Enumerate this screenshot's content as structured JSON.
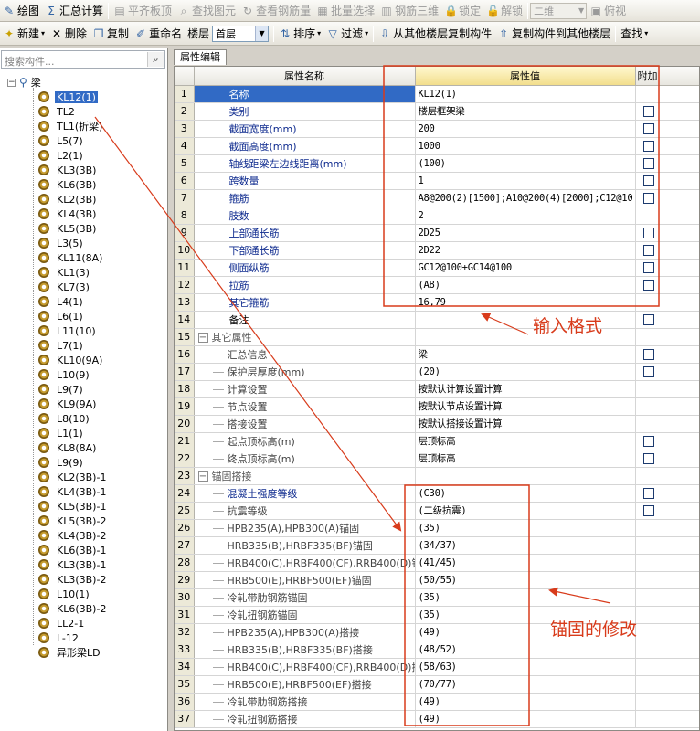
{
  "toolbar1": {
    "items": [
      {
        "label": "绘图",
        "icon": "✎",
        "name": "draw-button",
        "disabled": false
      },
      {
        "label": "汇总计算",
        "icon": "Σ",
        "name": "summary-calc-button",
        "disabled": false
      },
      {
        "label": "平齐板顶",
        "icon": "▤",
        "name": "align-slab-top-button",
        "disabled": true
      },
      {
        "label": "查找图元",
        "icon": "⌕",
        "name": "find-element-button",
        "disabled": true
      },
      {
        "label": "查看钢筋量",
        "icon": "↻",
        "name": "view-rebar-button",
        "disabled": true
      },
      {
        "label": "批量选择",
        "icon": "▦",
        "name": "batch-select-button",
        "disabled": true
      },
      {
        "label": "钢筋三维",
        "icon": "▥",
        "name": "rebar-3d-button",
        "disabled": true
      },
      {
        "label": "锁定",
        "icon": "🔒",
        "name": "lock-button",
        "disabled": true
      },
      {
        "label": "解锁",
        "icon": "🔓",
        "name": "unlock-button",
        "disabled": true
      }
    ],
    "view_mode": "二维",
    "view_label": "俯视"
  },
  "toolbar2": {
    "new_label": "新建",
    "delete_label": "删除",
    "copy_label": "复制",
    "rename_label": "重命名",
    "floor_label": "楼层",
    "floor_value": "首层",
    "sort_label": "排序",
    "filter_label": "过滤",
    "copy_from_label": "从其他楼层复制构件",
    "copy_to_label": "复制构件到其他楼层",
    "find_label": "查找"
  },
  "search": {
    "placeholder": "搜索构件..."
  },
  "tree": {
    "root": "梁",
    "items": [
      "KL12(1)",
      "TL2",
      "TL1(折梁)",
      "L5(7)",
      "L2(1)",
      "KL3(3B)",
      "KL6(3B)",
      "KL2(3B)",
      "KL4(3B)",
      "KL5(3B)",
      "L3(5)",
      "KL11(8A)",
      "KL1(3)",
      "KL7(3)",
      "L4(1)",
      "L6(1)",
      "L11(10)",
      "L7(1)",
      "KL10(9A)",
      "L10(9)",
      "L9(7)",
      "KL9(9A)",
      "L8(10)",
      "L1(1)",
      "KL8(8A)",
      "L9(9)",
      "KL2(3B)-1",
      "KL4(3B)-1",
      "KL5(3B)-1",
      "KL5(3B)-2",
      "KL4(3B)-2",
      "KL6(3B)-1",
      "KL3(3B)-1",
      "KL3(3B)-2",
      "L10(1)",
      "KL6(3B)-2",
      "LL2-1",
      "L-12",
      "异形梁LD"
    ],
    "selected_index": 0
  },
  "tab": {
    "label": "属性编辑"
  },
  "grid": {
    "headers": {
      "name": "属性名称",
      "value": "属性值",
      "add": "附加"
    },
    "rows": [
      {
        "n": "1",
        "name": "名称",
        "value": "KL12(1)",
        "style": "hl",
        "cb": false
      },
      {
        "n": "2",
        "name": "类别",
        "value": "楼层框架梁",
        "style": "blue",
        "cb": true
      },
      {
        "n": "3",
        "name": "截面宽度(mm)",
        "value": "200",
        "style": "blue",
        "cb": true
      },
      {
        "n": "4",
        "name": "截面高度(mm)",
        "value": "1000",
        "style": "blue",
        "cb": true
      },
      {
        "n": "5",
        "name": "轴线距梁左边线距离(mm)",
        "value": "(100)",
        "style": "blue",
        "cb": true
      },
      {
        "n": "6",
        "name": "跨数量",
        "value": "1",
        "style": "blue",
        "cb": true
      },
      {
        "n": "7",
        "name": "箍筋",
        "value": "A8@200(2)[1500];A10@200(4)[2000];C12@10",
        "style": "blue",
        "cb": true
      },
      {
        "n": "8",
        "name": "肢数",
        "value": "2",
        "style": "blue",
        "cb": false
      },
      {
        "n": "9",
        "name": "上部通长筋",
        "value": "2D25",
        "style": "blue",
        "cb": true
      },
      {
        "n": "10",
        "name": "下部通长筋",
        "value": "2D22",
        "style": "blue",
        "cb": true
      },
      {
        "n": "11",
        "name": "侧面纵筋",
        "value": "GC12@100+GC14@100",
        "style": "blue",
        "cb": true
      },
      {
        "n": "12",
        "name": "拉筋",
        "value": "(A8)",
        "style": "blue",
        "cb": true
      },
      {
        "n": "13",
        "name": "其它箍筋",
        "value": "16,79",
        "style": "blue",
        "cb": false
      },
      {
        "n": "14",
        "name": "备注",
        "value": "",
        "style": "plain",
        "cb": true
      },
      {
        "n": "15",
        "name": "其它属性",
        "value": "",
        "style": "group",
        "cb": false
      },
      {
        "n": "16",
        "name": "汇总信息",
        "value": "梁",
        "style": "sub",
        "cb": true
      },
      {
        "n": "17",
        "name": "保护层厚度(mm)",
        "value": "(20)",
        "style": "sub",
        "cb": true
      },
      {
        "n": "18",
        "name": "计算设置",
        "value": "按默认计算设置计算",
        "style": "sub",
        "cb": false
      },
      {
        "n": "19",
        "name": "节点设置",
        "value": "按默认节点设置计算",
        "style": "sub",
        "cb": false
      },
      {
        "n": "20",
        "name": "搭接设置",
        "value": "按默认搭接设置计算",
        "style": "sub",
        "cb": false
      },
      {
        "n": "21",
        "name": "起点顶标高(m)",
        "value": "层顶标高",
        "style": "sub",
        "cb": true
      },
      {
        "n": "22",
        "name": "终点顶标高(m)",
        "value": "层顶标高",
        "style": "sub",
        "cb": true
      },
      {
        "n": "23",
        "name": "锚固搭接",
        "value": "",
        "style": "group",
        "cb": false
      },
      {
        "n": "24",
        "name": "混凝土强度等级",
        "value": "(C30)",
        "style": "subblue",
        "cb": true
      },
      {
        "n": "25",
        "name": "抗震等级",
        "value": "(二级抗震)",
        "style": "sub",
        "cb": true
      },
      {
        "n": "26",
        "name": "HPB235(A),HPB300(A)锚固",
        "value": "(35)",
        "style": "sub",
        "cb": false
      },
      {
        "n": "27",
        "name": "HRB335(B),HRBF335(BF)锚固",
        "value": "(34/37)",
        "style": "sub",
        "cb": false
      },
      {
        "n": "28",
        "name": "HRB400(C),HRBF400(CF),RRB400(D)锚",
        "value": "(41/45)",
        "style": "sub",
        "cb": false
      },
      {
        "n": "29",
        "name": "HRB500(E),HRBF500(EF)锚固",
        "value": "(50/55)",
        "style": "sub",
        "cb": false
      },
      {
        "n": "30",
        "name": "冷轧带肋钢筋锚固",
        "value": "(35)",
        "style": "sub",
        "cb": false
      },
      {
        "n": "31",
        "name": "冷轧扭钢筋锚固",
        "value": "(35)",
        "style": "sub",
        "cb": false
      },
      {
        "n": "32",
        "name": "HPB235(A),HPB300(A)搭接",
        "value": "(49)",
        "style": "sub",
        "cb": false
      },
      {
        "n": "33",
        "name": "HRB335(B),HRBF335(BF)搭接",
        "value": "(48/52)",
        "style": "sub",
        "cb": false
      },
      {
        "n": "34",
        "name": "HRB400(C),HRBF400(CF),RRB400(D)搭",
        "value": "(58/63)",
        "style": "sub",
        "cb": false
      },
      {
        "n": "35",
        "name": "HRB500(E),HRBF500(EF)搭接",
        "value": "(70/77)",
        "style": "sub",
        "cb": false
      },
      {
        "n": "36",
        "name": "冷轧带肋钢筋搭接",
        "value": "(49)",
        "style": "sub",
        "cb": false
      },
      {
        "n": "37",
        "name": "冷轧扭钢筋搭接",
        "value": "(49)",
        "style": "sub",
        "cb": false
      }
    ]
  },
  "annotations": {
    "input_format": "输入格式",
    "anchor_modify": "锚固的修改",
    "color": "#d83b1b"
  }
}
